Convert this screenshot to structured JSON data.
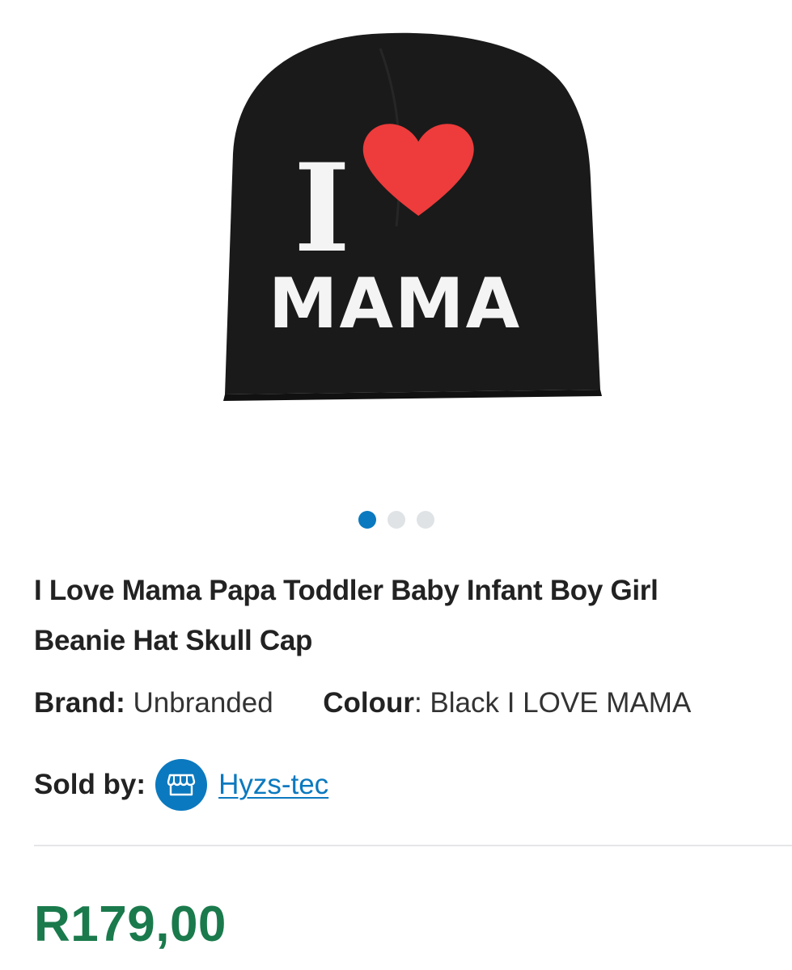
{
  "gallery": {
    "image_alt": "Black beanie hat printed with I ♥ MAMA",
    "print_line1": "I",
    "print_line2": "MAMA",
    "heart_color": "#ee3b3b",
    "hat_color": "#1a1a1a",
    "dots": [
      {
        "active": true
      },
      {
        "active": false
      },
      {
        "active": false
      }
    ]
  },
  "product": {
    "title": "I Love Mama Papa Toddler Baby Infant Boy Girl Beanie Hat Skull Cap",
    "brand_label": "Brand:",
    "brand_value": "Unbranded",
    "colour_label": "Colour",
    "colour_sep": ":",
    "colour_value": "Black I LOVE MAMA",
    "sold_by_label": "Sold by:",
    "shop_icon": "storefront-icon",
    "seller": "Hyzs-tec",
    "price": "R179,00"
  },
  "colors": {
    "accent": "#0b79bf",
    "price": "#1a7a4c",
    "dot_inactive": "#dfe3e6"
  }
}
